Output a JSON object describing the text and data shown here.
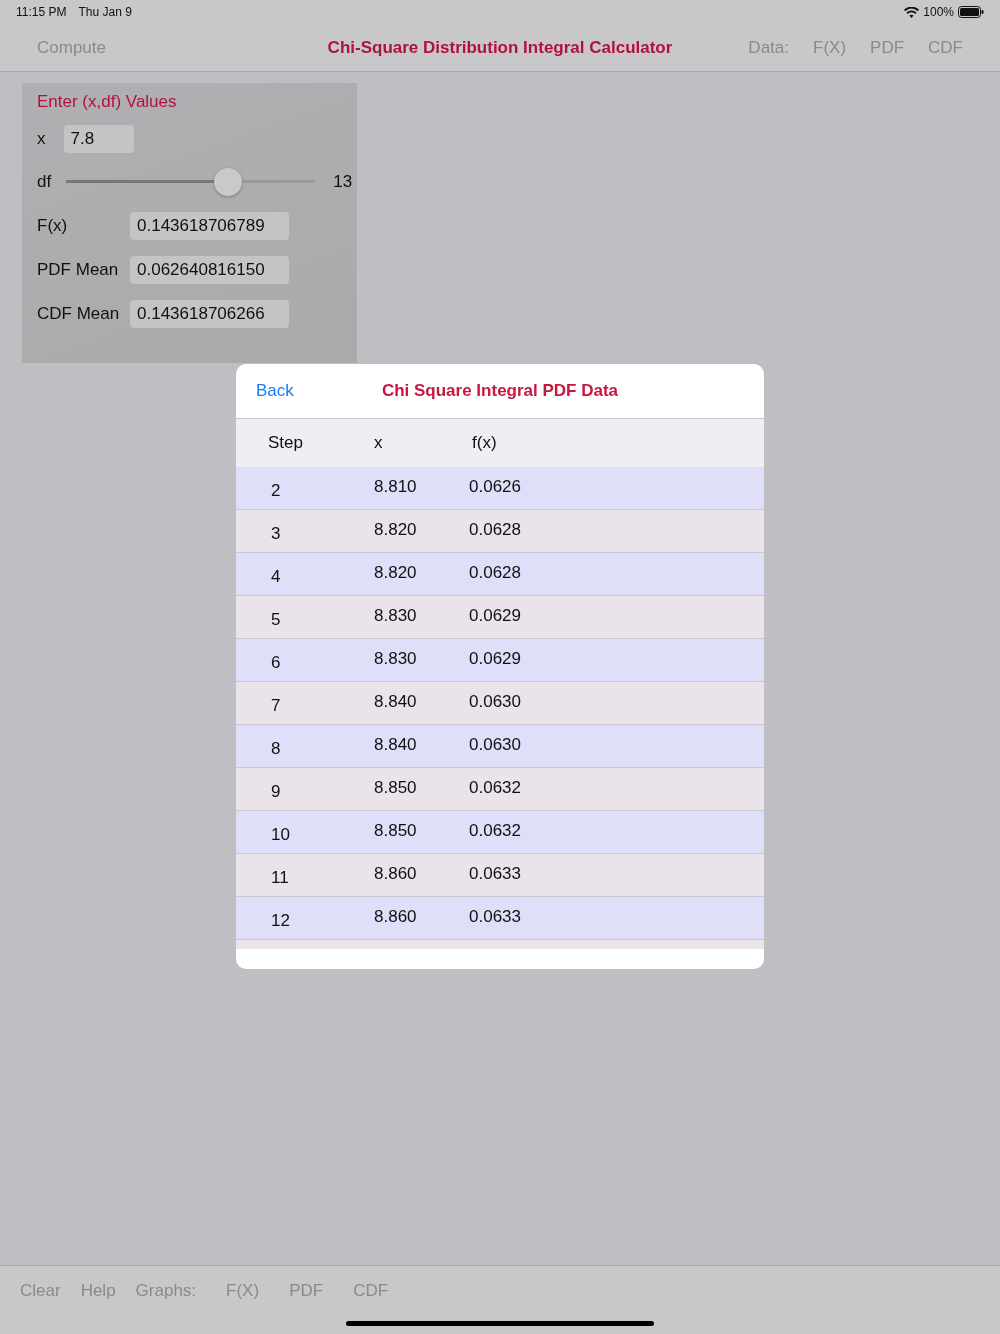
{
  "status_bar": {
    "time": "11:15 PM",
    "date": "Thu Jan 9",
    "battery": "100%"
  },
  "nav_bar": {
    "left": "Compute",
    "title": "Chi-Square Distribution Integral Calculator",
    "right": [
      "Data:",
      "F(X)",
      "PDF",
      "CDF"
    ]
  },
  "input_panel": {
    "title": "Enter (x,df) Values",
    "x_label": "x",
    "x_value": "7.8",
    "df_label": "df",
    "df_slider": {
      "level": 0.65
    },
    "df_value": "13",
    "results": [
      {
        "label": "F(x)",
        "value": "0.143618706789"
      },
      {
        "label": "PDF Mean",
        "value": "0.062640816150"
      },
      {
        "label": "CDF Mean",
        "value": "0.143618706266"
      }
    ]
  },
  "data_sheet": {
    "back": "Back",
    "title": "Chi Square Integral PDF Data",
    "columns": [
      "Step",
      "x",
      "f(x)"
    ],
    "rows": [
      [
        "2",
        "8.810",
        "0.0626"
      ],
      [
        "3",
        "8.820",
        "0.0628"
      ],
      [
        "4",
        "8.820",
        "0.0628"
      ],
      [
        "5",
        "8.830",
        "0.0629"
      ],
      [
        "6",
        "8.830",
        "0.0629"
      ],
      [
        "7",
        "8.840",
        "0.0630"
      ],
      [
        "8",
        "8.840",
        "0.0630"
      ],
      [
        "9",
        "8.850",
        "0.0632"
      ],
      [
        "10",
        "8.850",
        "0.0632"
      ],
      [
        "11",
        "8.860",
        "0.0633"
      ],
      [
        "12",
        "8.860",
        "0.0633"
      ]
    ]
  },
  "bottom_bar": [
    "Clear",
    "Help",
    "Graphs:",
    "F(X)",
    "PDF",
    "CDF"
  ]
}
